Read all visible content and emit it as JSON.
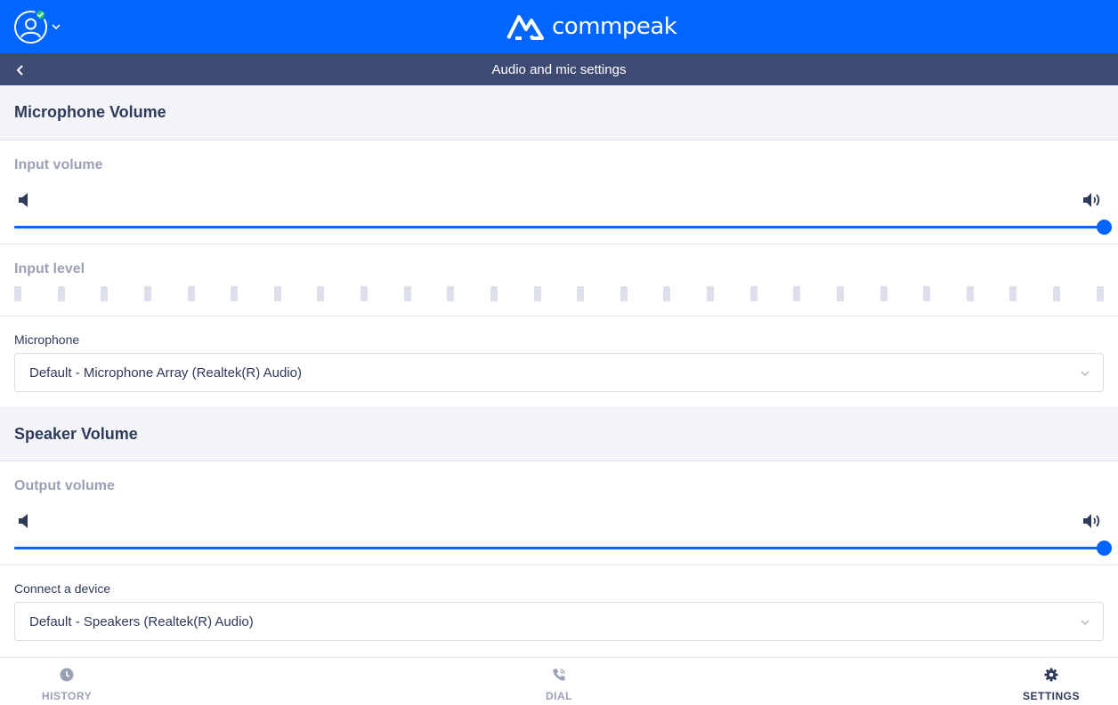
{
  "header": {
    "brand": "commpeak",
    "user_status": "online"
  },
  "subheader": {
    "title": "Audio and mic settings"
  },
  "microphone": {
    "section_title": "Microphone Volume",
    "input_volume_label": "Input volume",
    "input_volume_value": 1.0,
    "input_level_label": "Input level",
    "input_level_active_bars": 0,
    "input_level_bar_count": 26,
    "device_label": "Microphone",
    "device_value": "Default - Microphone Array (Realtek(R) Audio)"
  },
  "speaker": {
    "section_title": "Speaker Volume",
    "output_volume_label": "Output volume",
    "output_volume_value": 1.0,
    "device_label": "Connect a device",
    "device_value": "Default - Speakers (Realtek(R) Audio)"
  },
  "nav": {
    "history": "HISTORY",
    "dial": "DIAL",
    "settings": "SETTINGS",
    "active": "settings"
  },
  "colors": {
    "primary": "#0066ff",
    "subbar": "#3d4a72",
    "status_online": "#1ec96b",
    "text_dark": "#2e3a59",
    "text_muted": "#9aa1b4"
  },
  "icons": {
    "avatar": "user-avatar-icon",
    "status": "check-icon",
    "dropdown": "chevron-down-icon",
    "back": "chevron-left-icon",
    "volume_low": "speaker-low-icon",
    "volume_high": "speaker-high-icon",
    "history": "clock-icon",
    "dial": "phone-icon",
    "settings": "gear-icon"
  }
}
